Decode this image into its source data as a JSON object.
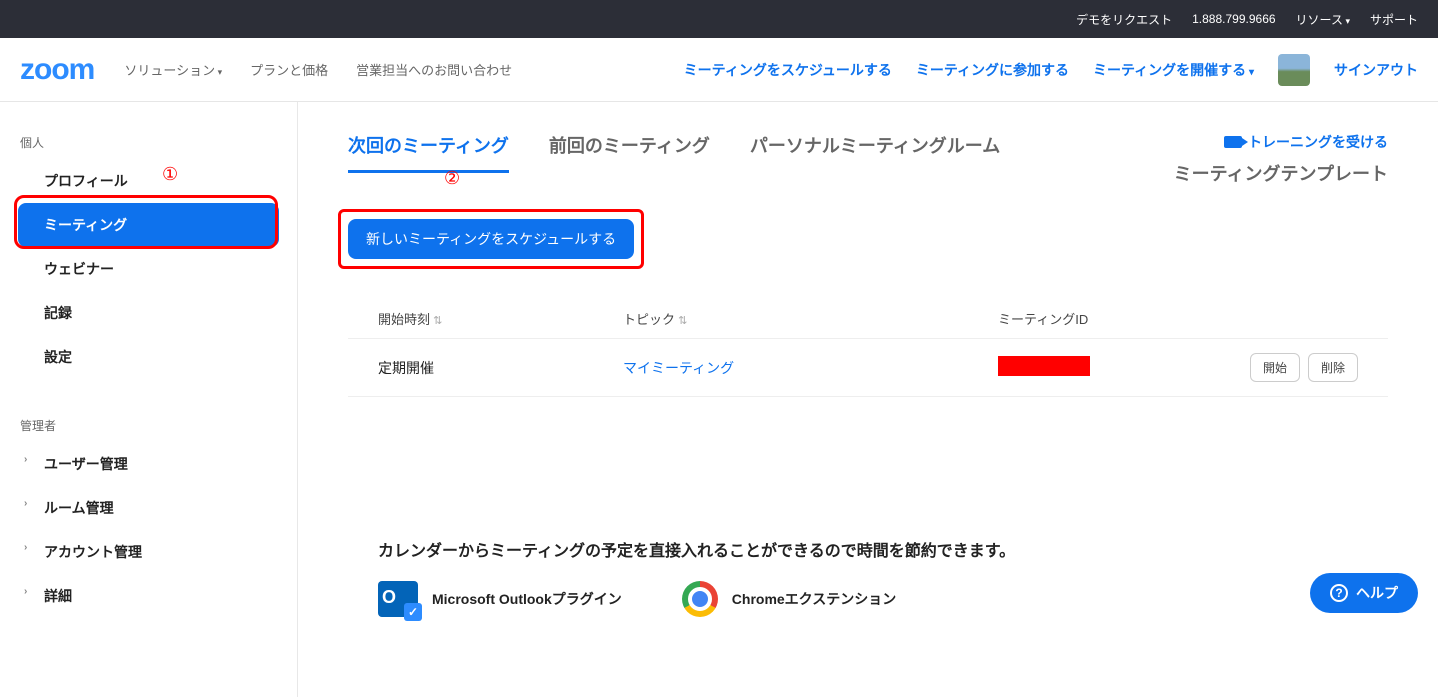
{
  "topbar": {
    "demo": "デモをリクエスト",
    "phone": "1.888.799.9666",
    "resources": "リソース",
    "support": "サポート"
  },
  "header": {
    "logo": "zoom",
    "nav": {
      "solutions": "ソリューション",
      "plans": "プランと価格",
      "contact": "営業担当へのお問い合わせ"
    },
    "actions": {
      "schedule": "ミーティングをスケジュールする",
      "join": "ミーティングに参加する",
      "host": "ミーティングを開催する",
      "signout": "サインアウト"
    }
  },
  "sidebar": {
    "personal_heading": "個人",
    "items": {
      "profile": "プロフィール",
      "meeting": "ミーティング",
      "webinar": "ウェビナー",
      "recording": "記録",
      "settings": "設定"
    },
    "admin_heading": "管理者",
    "admin": {
      "user": "ユーザー管理",
      "room": "ルーム管理",
      "account": "アカウント管理",
      "advanced": "詳細"
    }
  },
  "annotations": {
    "one": "①",
    "two": "②"
  },
  "tabs": {
    "upcoming": "次回のミーティング",
    "previous": "前回のミーティング",
    "personal_room": "パーソナルミーティングルーム",
    "templates": "ミーティングテンプレート",
    "training": "トレーニングを受ける"
  },
  "schedule_button": "新しいミーティングをスケジュールする",
  "table": {
    "headers": {
      "start_time": "開始時刻",
      "topic": "トピック",
      "meeting_id": "ミーティングID"
    },
    "row": {
      "time": "定期開催",
      "topic": "マイミーティング"
    },
    "actions": {
      "start": "開始",
      "delete": "削除"
    }
  },
  "calendar": {
    "title": "カレンダーからミーティングの予定を直接入れることができるので時間を節約できます。",
    "outlook": "Microsoft Outlookプラグイン",
    "chrome": "Chromeエクステンション"
  },
  "help": "ヘルプ"
}
